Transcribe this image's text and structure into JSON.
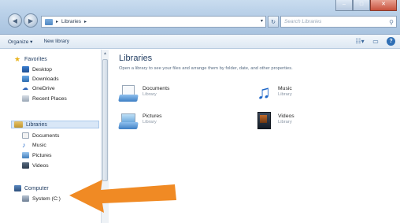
{
  "window": {
    "controls": [
      "–",
      "□",
      "✕"
    ]
  },
  "address_bar": {
    "path": "Libraries",
    "separator": "▸",
    "dropdown": "▾",
    "refresh": "↻",
    "search_placeholder": "Search Libraries"
  },
  "toolbar": {
    "organize": "Organize ▾",
    "new_library": "New library"
  },
  "sidebar": {
    "favorites": {
      "title": "Favorites",
      "items": [
        {
          "label": "Desktop",
          "icon": "desktop-icon"
        },
        {
          "label": "Downloads",
          "icon": "downloads-icon"
        },
        {
          "label": "OneDrive",
          "icon": "onedrive-icon"
        },
        {
          "label": "Recent Places",
          "icon": "recent-places-icon"
        }
      ]
    },
    "libraries": {
      "title": "Libraries",
      "items": [
        {
          "label": "Documents",
          "icon": "documents-icon"
        },
        {
          "label": "Music",
          "icon": "music-icon"
        },
        {
          "label": "Pictures",
          "icon": "pictures-icon"
        },
        {
          "label": "Videos",
          "icon": "videos-icon"
        }
      ]
    },
    "computer": {
      "title": "Computer",
      "items": [
        {
          "label": "System (C:)",
          "icon": "drive-icon"
        }
      ]
    }
  },
  "main": {
    "title": "Libraries",
    "description": "Open a library to see your files and arrange them by folder, date, and other properties.",
    "libraries": [
      {
        "name": "Documents",
        "type": "Library"
      },
      {
        "name": "Music",
        "type": "Library"
      },
      {
        "name": "Pictures",
        "type": "Library"
      },
      {
        "name": "Videos",
        "type": "Library"
      }
    ]
  },
  "colors": {
    "annotation_arrow": "#f08a24",
    "selected_bg": "#d9e7f7",
    "title_blue": "#1e3a5f"
  }
}
